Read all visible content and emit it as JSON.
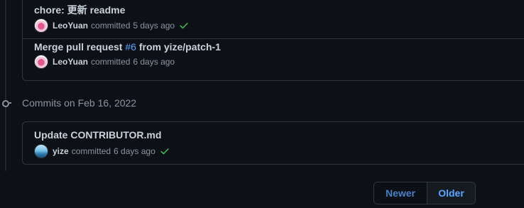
{
  "timeline": {
    "groups": [
      {
        "commits": [
          {
            "title": "chore: 更新 readme",
            "author": "LeoYuan",
            "action": "committed",
            "time": "5 days ago",
            "status": "success"
          },
          {
            "title_prefix": "Merge pull request ",
            "pr_ref": "#6",
            "title_suffix": " from yize/patch-1",
            "author": "LeoYuan",
            "action": "committed",
            "time": "6 days ago"
          }
        ]
      },
      {
        "header": "Commits on Feb 16, 2022",
        "commits": [
          {
            "title": "Update CONTRIBUTOR.md",
            "author": "yize",
            "action": "committed",
            "time": "6 days ago",
            "status": "success"
          }
        ]
      }
    ]
  },
  "pagination": {
    "newer_label": "Newer",
    "older_label": "Older"
  },
  "colors": {
    "background": "#0d1117",
    "border": "#30363d",
    "text": "#c9d1d9",
    "muted": "#8b949e",
    "link": "#58a6ff",
    "success": "#3fb950"
  }
}
